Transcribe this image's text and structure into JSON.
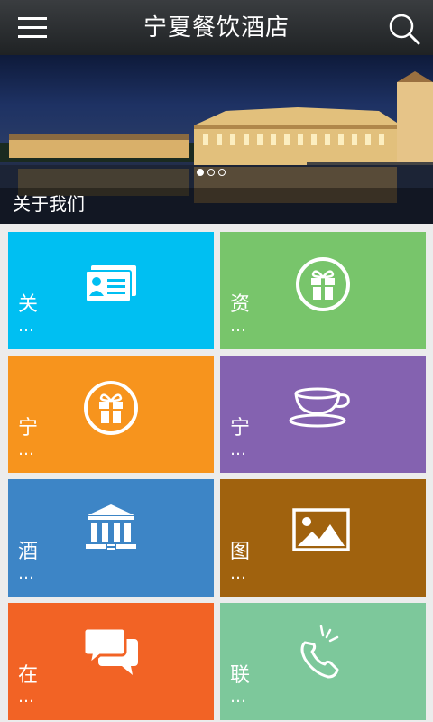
{
  "header": {
    "title": "宁夏餐饮酒店",
    "menu_icon": "hamburger-menu-icon",
    "search_icon": "search-icon"
  },
  "banner": {
    "caption": "关于我们",
    "slides_total": 3,
    "active_slide": 1
  },
  "tiles": [
    {
      "char": "关",
      "ellipsis": "…",
      "color": "#00bff2",
      "icon": "id-card-icon"
    },
    {
      "char": "资",
      "ellipsis": "…",
      "color": "#78c56b",
      "icon": "gift-icon"
    },
    {
      "char": "宁",
      "ellipsis": "…",
      "color": "#f7941d",
      "icon": "gift-icon"
    },
    {
      "char": "宁",
      "ellipsis": "…",
      "color": "#8462b0",
      "icon": "teacup-icon"
    },
    {
      "char": "酒",
      "ellipsis": "…",
      "color": "#3d85c6",
      "icon": "building-icon"
    },
    {
      "char": "图",
      "ellipsis": "…",
      "color": "#a0620e",
      "icon": "picture-icon"
    },
    {
      "char": "在",
      "ellipsis": "…",
      "color": "#f26325",
      "icon": "chat-bubbles-icon"
    },
    {
      "char": "联",
      "ellipsis": "…",
      "color": "#7dc89b",
      "icon": "phone-icon"
    }
  ]
}
